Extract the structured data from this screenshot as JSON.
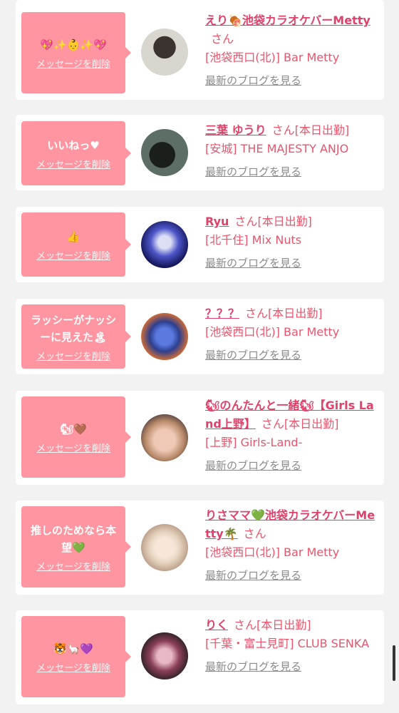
{
  "cards": [
    {
      "message": "💖✨👶✨💖",
      "delete_label": "メッセージを削除",
      "name": "えり🍖池袋カラオケバーMetty",
      "san": "さん",
      "status": "",
      "shop": "[池袋西口(北)] Bar Metty",
      "blog_label": "最新のブログを見る",
      "avatar_colors": [
        "#d9d6d0",
        "#3a3330"
      ]
    },
    {
      "message": "いいねっ♥",
      "delete_label": "メッセージを削除",
      "name": "三葉 ゆうり",
      "san": "さん",
      "status": "[本日出勤]",
      "shop": "[安城] THE MAJESTY ANJO",
      "blog_label": "最新のブログを見る",
      "avatar_colors": [
        "#2f3a33",
        "#5c6e66"
      ]
    },
    {
      "message": "👍",
      "delete_label": "メッセージを削除",
      "name": "Ryu",
      "san": "さん",
      "status": "[本日出勤]",
      "shop": "[北千住] Mix Nuts",
      "blog_label": "最新のブログを見る",
      "avatar_colors": [
        "#15185c",
        "#4e56c9"
      ]
    },
    {
      "message": "ラッシーがナッシーに見えた🏝",
      "delete_label": "メッセージを削除",
      "name": "？？？",
      "san": "さん",
      "status": "[本日出勤]",
      "shop": "[池袋西口(北)] Bar Metty",
      "blog_label": "最新のブログを見る",
      "avatar_colors": [
        "#2e3f8f",
        "#c96a3a"
      ]
    },
    {
      "message": "🐿🤎",
      "delete_label": "メッセージを削除",
      "name": "🐿のんたんと一緒🐿【Girls Land上野】",
      "san": "さん",
      "status": "[本日出勤]",
      "shop": "[上野] Girls-Land-",
      "blog_label": "最新のブログを見る",
      "avatar_colors": [
        "#b88a6a",
        "#f0c9b6"
      ]
    },
    {
      "message": "推しのためなら本望💚",
      "delete_label": "メッセージを削除",
      "name": "りさママ💚池袋カラオケバーMetty🌴",
      "san": "さん",
      "status": "",
      "shop": "[池袋西口(北)] Bar Metty",
      "blog_label": "最新のブログを見る",
      "avatar_colors": [
        "#e8d6c2",
        "#b69a84"
      ]
    },
    {
      "message": "🐯🦙💜",
      "delete_label": "メッセージを削除",
      "name": "りく",
      "san": "さん",
      "status": "[本日出勤]",
      "shop": "[千葉・富士見町] CLUB SENKA",
      "blog_label": "最新のブログを見る",
      "avatar_colors": [
        "#2a1f24",
        "#8a3f58"
      ]
    }
  ]
}
